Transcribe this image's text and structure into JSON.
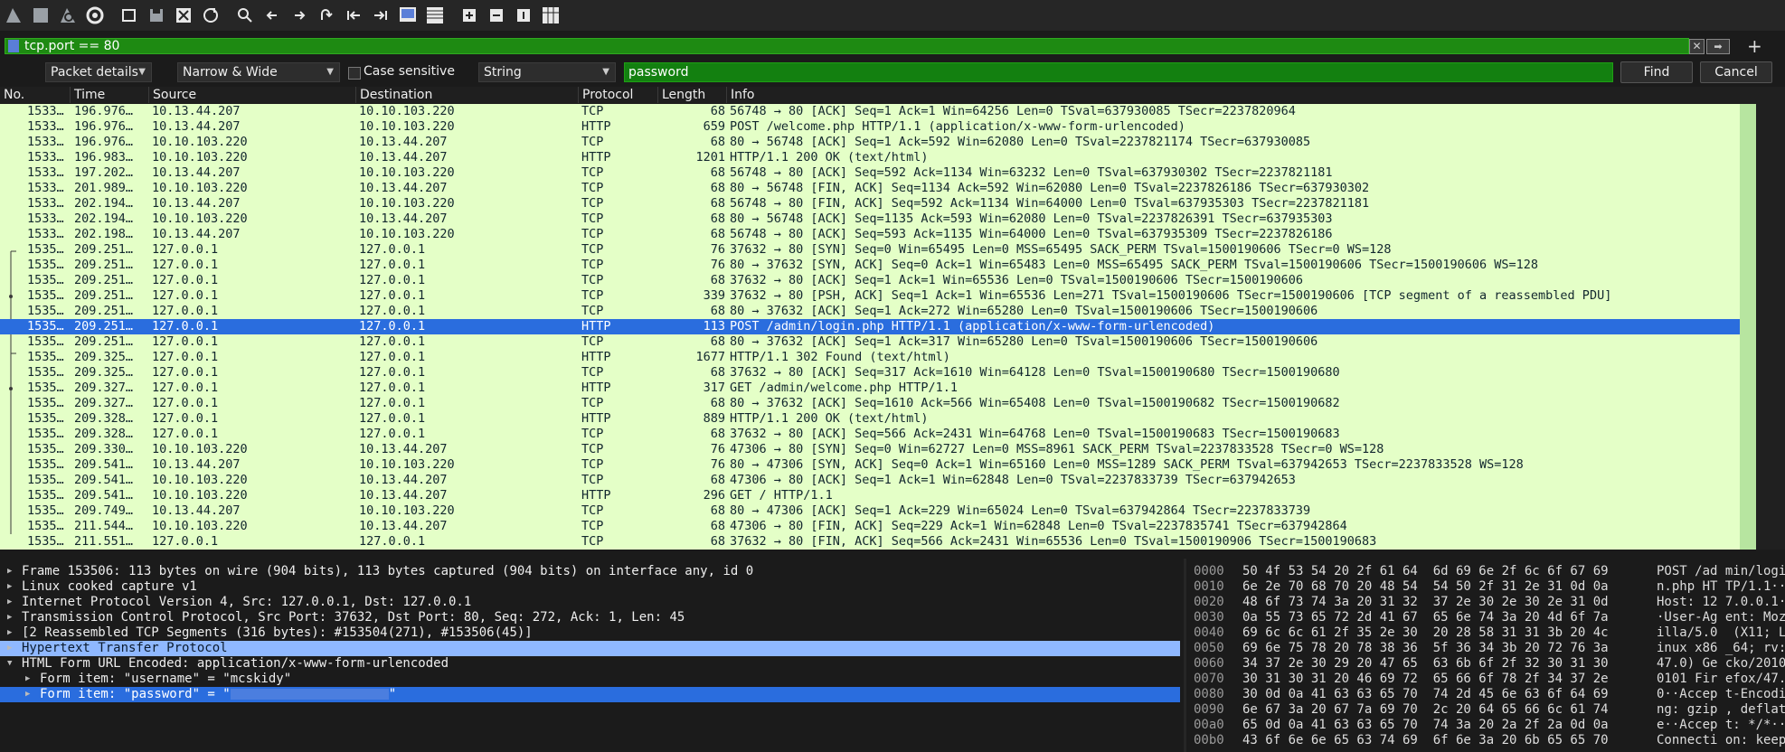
{
  "toolbar": {
    "icons": [
      "shark-fin-start-icon",
      "stop-square-icon",
      "shark-fin-restart-icon",
      "gear-options-icon",
      "open-file-icon",
      "save-file-icon",
      "close-file-icon",
      "reload-icon",
      "search-icon",
      "back-arrow-icon",
      "forward-arrow-icon",
      "go-to-packet-icon",
      "first-packet-icon",
      "last-packet-icon",
      "auto-scroll-icon",
      "colorize-icon",
      "zoom-in-icon",
      "zoom-out-icon",
      "normal-size-icon",
      "resize-columns-icon"
    ]
  },
  "filter": {
    "value": "tcp.port == 80"
  },
  "find": {
    "search_in": "Packet details",
    "char_width": "Narrow & Wide",
    "case_sensitive": "Case sensitive",
    "search_type": "String",
    "query": "password",
    "find_label": "Find",
    "cancel_label": "Cancel"
  },
  "columns": [
    "No.",
    "Time",
    "Source",
    "Destination",
    "Protocol",
    "Length",
    "Info"
  ],
  "packets": [
    {
      "no": "1533…",
      "time": "196.976…",
      "src": "10.13.44.207",
      "dst": "10.10.103.220",
      "proto": "TCP",
      "len": "68",
      "info": "56748 → 80 [ACK] Seq=1 Ack=1 Win=64256 Len=0 TSval=637930085 TSecr=2237820964"
    },
    {
      "no": "1533…",
      "time": "196.976…",
      "src": "10.13.44.207",
      "dst": "10.10.103.220",
      "proto": "HTTP",
      "len": "659",
      "info": "POST /welcome.php HTTP/1.1  (application/x-www-form-urlencoded)"
    },
    {
      "no": "1533…",
      "time": "196.976…",
      "src": "10.10.103.220",
      "dst": "10.13.44.207",
      "proto": "TCP",
      "len": "68",
      "info": "80 → 56748 [ACK] Seq=1 Ack=592 Win=62080 Len=0 TSval=2237821174 TSecr=637930085"
    },
    {
      "no": "1533…",
      "time": "196.983…",
      "src": "10.10.103.220",
      "dst": "10.13.44.207",
      "proto": "HTTP",
      "len": "1201",
      "info": "HTTP/1.1 200 OK  (text/html)"
    },
    {
      "no": "1533…",
      "time": "197.202…",
      "src": "10.13.44.207",
      "dst": "10.10.103.220",
      "proto": "TCP",
      "len": "68",
      "info": "56748 → 80 [ACK] Seq=592 Ack=1134 Win=63232 Len=0 TSval=637930302 TSecr=2237821181"
    },
    {
      "no": "1533…",
      "time": "201.989…",
      "src": "10.10.103.220",
      "dst": "10.13.44.207",
      "proto": "TCP",
      "len": "68",
      "info": "80 → 56748 [FIN, ACK] Seq=1134 Ack=592 Win=62080 Len=0 TSval=2237826186 TSecr=637930302"
    },
    {
      "no": "1533…",
      "time": "202.194…",
      "src": "10.13.44.207",
      "dst": "10.10.103.220",
      "proto": "TCP",
      "len": "68",
      "info": "56748 → 80 [FIN, ACK] Seq=592 Ack=1134 Win=64000 Len=0 TSval=637935303 TSecr=2237821181"
    },
    {
      "no": "1533…",
      "time": "202.194…",
      "src": "10.10.103.220",
      "dst": "10.13.44.207",
      "proto": "TCP",
      "len": "68",
      "info": "80 → 56748 [ACK] Seq=1135 Ack=593 Win=62080 Len=0 TSval=2237826391 TSecr=637935303"
    },
    {
      "no": "1533…",
      "time": "202.198…",
      "src": "10.13.44.207",
      "dst": "10.10.103.220",
      "proto": "TCP",
      "len": "68",
      "info": "56748 → 80 [ACK] Seq=593 Ack=1135 Win=64000 Len=0 TSval=637935309 TSecr=2237826186"
    },
    {
      "no": "1535…",
      "time": "209.251…",
      "src": "127.0.0.1",
      "dst": "127.0.0.1",
      "proto": "TCP",
      "len": "76",
      "info": "37632 → 80 [SYN] Seq=0 Win=65495 Len=0 MSS=65495 SACK_PERM TSval=1500190606 TSecr=0 WS=128"
    },
    {
      "no": "1535…",
      "time": "209.251…",
      "src": "127.0.0.1",
      "dst": "127.0.0.1",
      "proto": "TCP",
      "len": "76",
      "info": "80 → 37632 [SYN, ACK] Seq=0 Ack=1 Win=65483 Len=0 MSS=65495 SACK_PERM TSval=1500190606 TSecr=1500190606 WS=128"
    },
    {
      "no": "1535…",
      "time": "209.251…",
      "src": "127.0.0.1",
      "dst": "127.0.0.1",
      "proto": "TCP",
      "len": "68",
      "info": "37632 → 80 [ACK] Seq=1 Ack=1 Win=65536 Len=0 TSval=1500190606 TSecr=1500190606"
    },
    {
      "no": "1535…",
      "time": "209.251…",
      "src": "127.0.0.1",
      "dst": "127.0.0.1",
      "proto": "TCP",
      "len": "339",
      "info": "37632 → 80 [PSH, ACK] Seq=1 Ack=1 Win=65536 Len=271 TSval=1500190606 TSecr=1500190606 [TCP segment of a reassembled PDU]"
    },
    {
      "no": "1535…",
      "time": "209.251…",
      "src": "127.0.0.1",
      "dst": "127.0.0.1",
      "proto": "TCP",
      "len": "68",
      "info": "80 → 37632 [ACK] Seq=1 Ack=272 Win=65280 Len=0 TSval=1500190606 TSecr=1500190606"
    },
    {
      "no": "1535…",
      "time": "209.251…",
      "src": "127.0.0.1",
      "dst": "127.0.0.1",
      "proto": "HTTP",
      "len": "113",
      "info": "POST /admin/login.php HTTP/1.1  (application/x-www-form-urlencoded)"
    },
    {
      "no": "1535…",
      "time": "209.251…",
      "src": "127.0.0.1",
      "dst": "127.0.0.1",
      "proto": "TCP",
      "len": "68",
      "info": "80 → 37632 [ACK] Seq=1 Ack=317 Win=65280 Len=0 TSval=1500190606 TSecr=1500190606"
    },
    {
      "no": "1535…",
      "time": "209.325…",
      "src": "127.0.0.1",
      "dst": "127.0.0.1",
      "proto": "HTTP",
      "len": "1677",
      "info": "HTTP/1.1 302 Found  (text/html)"
    },
    {
      "no": "1535…",
      "time": "209.325…",
      "src": "127.0.0.1",
      "dst": "127.0.0.1",
      "proto": "TCP",
      "len": "68",
      "info": "37632 → 80 [ACK] Seq=317 Ack=1610 Win=64128 Len=0 TSval=1500190680 TSecr=1500190680"
    },
    {
      "no": "1535…",
      "time": "209.327…",
      "src": "127.0.0.1",
      "dst": "127.0.0.1",
      "proto": "HTTP",
      "len": "317",
      "info": "GET /admin/welcome.php HTTP/1.1"
    },
    {
      "no": "1535…",
      "time": "209.327…",
      "src": "127.0.0.1",
      "dst": "127.0.0.1",
      "proto": "TCP",
      "len": "68",
      "info": "80 → 37632 [ACK] Seq=1610 Ack=566 Win=65408 Len=0 TSval=1500190682 TSecr=1500190682"
    },
    {
      "no": "1535…",
      "time": "209.328…",
      "src": "127.0.0.1",
      "dst": "127.0.0.1",
      "proto": "HTTP",
      "len": "889",
      "info": "HTTP/1.1 200 OK  (text/html)"
    },
    {
      "no": "1535…",
      "time": "209.328…",
      "src": "127.0.0.1",
      "dst": "127.0.0.1",
      "proto": "TCP",
      "len": "68",
      "info": "37632 → 80 [ACK] Seq=566 Ack=2431 Win=64768 Len=0 TSval=1500190683 TSecr=1500190683"
    },
    {
      "no": "1535…",
      "time": "209.330…",
      "src": "10.10.103.220",
      "dst": "10.13.44.207",
      "proto": "TCP",
      "len": "76",
      "info": "47306 → 80 [SYN] Seq=0 Win=62727 Len=0 MSS=8961 SACK_PERM TSval=2237833528 TSecr=0 WS=128"
    },
    {
      "no": "1535…",
      "time": "209.541…",
      "src": "10.13.44.207",
      "dst": "10.10.103.220",
      "proto": "TCP",
      "len": "76",
      "info": "80 → 47306 [SYN, ACK] Seq=0 Ack=1 Win=65160 Len=0 MSS=1289 SACK_PERM TSval=637942653 TSecr=2237833528 WS=128"
    },
    {
      "no": "1535…",
      "time": "209.541…",
      "src": "10.10.103.220",
      "dst": "10.13.44.207",
      "proto": "TCP",
      "len": "68",
      "info": "47306 → 80 [ACK] Seq=1 Ack=1 Win=62848 Len=0 TSval=2237833739 TSecr=637942653"
    },
    {
      "no": "1535…",
      "time": "209.541…",
      "src": "10.10.103.220",
      "dst": "10.13.44.207",
      "proto": "HTTP",
      "len": "296",
      "info": "GET / HTTP/1.1"
    },
    {
      "no": "1535…",
      "time": "209.749…",
      "src": "10.13.44.207",
      "dst": "10.10.103.220",
      "proto": "TCP",
      "len": "68",
      "info": "80 → 47306 [ACK] Seq=1 Ack=229 Win=65024 Len=0 TSval=637942864 TSecr=2237833739"
    },
    {
      "no": "1535…",
      "time": "211.544…",
      "src": "10.10.103.220",
      "dst": "10.13.44.207",
      "proto": "TCP",
      "len": "68",
      "info": "47306 → 80 [FIN, ACK] Seq=229 Ack=1 Win=62848 Len=0 TSval=2237835741 TSecr=637942864"
    },
    {
      "no": "1535…",
      "time": "211.551…",
      "src": "127.0.0.1",
      "dst": "127.0.0.1",
      "proto": "TCP",
      "len": "68",
      "info": "37632 → 80 [FIN, ACK] Seq=566 Ack=2431 Win=65536 Len=0 TSval=1500190906 TSecr=1500190683"
    }
  ],
  "selected_packet_index": 14,
  "details": [
    {
      "indent": 0,
      "expanded": false,
      "text": "Frame 153506: 113 bytes on wire (904 bits), 113 bytes captured (904 bits) on interface any, id 0"
    },
    {
      "indent": 0,
      "expanded": false,
      "text": "Linux cooked capture v1"
    },
    {
      "indent": 0,
      "expanded": false,
      "text": "Internet Protocol Version 4, Src: 127.0.0.1, Dst: 127.0.0.1"
    },
    {
      "indent": 0,
      "expanded": false,
      "text": "Transmission Control Protocol, Src Port: 37632, Dst Port: 80, Seq: 272, Ack: 1, Len: 45"
    },
    {
      "indent": 0,
      "expanded": false,
      "text": "[2 Reassembled TCP Segments (316 bytes): #153504(271), #153506(45)]"
    },
    {
      "indent": 0,
      "expanded": false,
      "text": "Hypertext Transfer Protocol"
    },
    {
      "indent": 0,
      "expanded": true,
      "text": "HTML Form URL Encoded: application/x-www-form-urlencoded"
    },
    {
      "indent": 1,
      "expanded": false,
      "text": "Form item: \"username\" = \"mcskidy\""
    },
    {
      "indent": 1,
      "expanded": false,
      "text": "Form item: \"password\" = \"",
      "redacted": true,
      "suffix": "\""
    }
  ],
  "bytes": [
    {
      "off": "0000",
      "hex": "50 4f 53 54 20 2f 61 64  6d 69 6e 2f 6c 6f 67 69",
      "ascii": "POST /ad min/logi"
    },
    {
      "off": "0010",
      "hex": "6e 2e 70 68 70 20 48 54  54 50 2f 31 2e 31 0d 0a",
      "ascii": "n.php HT TP/1.1··"
    },
    {
      "off": "0020",
      "hex": "48 6f 73 74 3a 20 31 32  37 2e 30 2e 30 2e 31 0d",
      "ascii": "Host: 12 7.0.0.1·"
    },
    {
      "off": "0030",
      "hex": "0a 55 73 65 72 2d 41 67  65 6e 74 3a 20 4d 6f 7a",
      "ascii": "·User-Ag ent: Moz"
    },
    {
      "off": "0040",
      "hex": "69 6c 6c 61 2f 35 2e 30  20 28 58 31 31 3b 20 4c",
      "ascii": "illa/5.0  (X11; L"
    },
    {
      "off": "0050",
      "hex": "69 6e 75 78 20 78 38 36  5f 36 34 3b 20 72 76 3a",
      "ascii": "inux x86 _64; rv:"
    },
    {
      "off": "0060",
      "hex": "34 37 2e 30 29 20 47 65  63 6b 6f 2f 32 30 31 30",
      "ascii": "47.0) Ge cko/2010"
    },
    {
      "off": "0070",
      "hex": "30 31 30 31 20 46 69 72  65 66 6f 78 2f 34 37 2e",
      "ascii": "0101 Fir efox/47."
    },
    {
      "off": "0080",
      "hex": "30 0d 0a 41 63 63 65 70  74 2d 45 6e 63 6f 64 69",
      "ascii": "0··Accep t-Encodi"
    },
    {
      "off": "0090",
      "hex": "6e 67 3a 20 67 7a 69 70  2c 20 64 65 66 6c 61 74",
      "ascii": "ng: gzip , deflat"
    },
    {
      "off": "00a0",
      "hex": "65 0d 0a 41 63 63 65 70  74 3a 20 2a 2f 2a 0d 0a",
      "ascii": "e··Accep t: */*··"
    },
    {
      "off": "00b0",
      "hex": "43 6f 6e 6e 65 63 74 69  6f 6e 3a 20 6b 65 65 70",
      "ascii": "Connecti on: keep"
    }
  ],
  "colors": {
    "filter_green": "#1e8a12",
    "row_bg": "#e4ffc7",
    "selected": "#2a6dde",
    "section_highlight": "#8fb8ff"
  }
}
